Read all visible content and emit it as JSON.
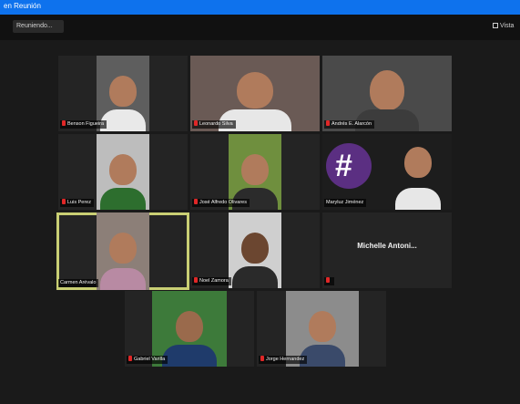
{
  "window": {
    "title": "en Reunión"
  },
  "toolbar": {
    "left_label": "Reuniendo...",
    "view_label": "Vista",
    "view_icon": "grid-icon"
  },
  "participants": [
    {
      "name": "Benson Figueira",
      "muted": true,
      "video": true,
      "shirt": "#e9e9e9",
      "bg": "#5e5e5e"
    },
    {
      "name": "Leonardo Silva",
      "muted": true,
      "video": true,
      "shirt": "#e7e7e7",
      "bg": "#6a5a55"
    },
    {
      "name": "Andrés E. Alarcón",
      "muted": true,
      "video": true,
      "shirt": "#3c3c3c",
      "bg": "#4a4a4a"
    },
    {
      "name": "Luis Perez",
      "muted": true,
      "video": true,
      "shirt": "#2d6e2e",
      "bg": "#bdbdbd"
    },
    {
      "name": "José Alfredo Olivares",
      "muted": true,
      "video": true,
      "shirt": "#2b2b2b",
      "bg": "#6f8f3e"
    },
    {
      "name": "Maryluz Jiménez",
      "muted": false,
      "video": true,
      "shirt": "#e7e7e7",
      "bg": "#6a3c8f"
    },
    {
      "name": "Carmen Arévalo",
      "muted": false,
      "video": true,
      "active_speaker": true,
      "shirt": "#b88aa3",
      "bg": "#8c7f78"
    },
    {
      "name": "Noel Zamora",
      "muted": true,
      "video": true,
      "shirt": "#2a2a2a",
      "bg": "#cfcfcf"
    },
    {
      "name": "Michelle Antoni...",
      "muted": true,
      "video": false
    },
    {
      "name": "Gabriel Varilla",
      "muted": true,
      "video": true,
      "shirt": "#1f3b6b",
      "bg": "#3d7a3a"
    },
    {
      "name": "Jorge Hernandez",
      "muted": true,
      "video": true,
      "shirt": "#3a4a6a",
      "bg": "#8c8c8c"
    }
  ]
}
